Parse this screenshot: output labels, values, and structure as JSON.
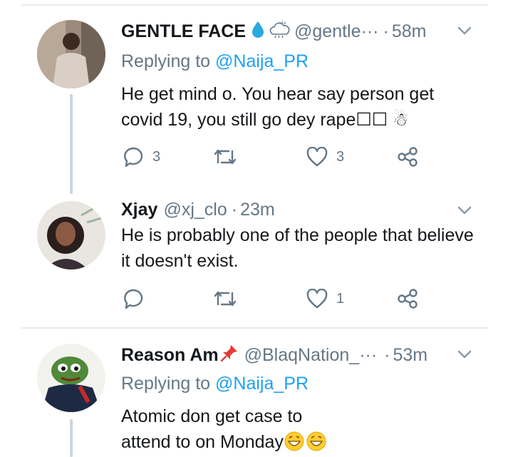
{
  "tweets": [
    {
      "name": "GENTLE FACE",
      "handle": "@gentle···",
      "time": "58m",
      "replying_prefix": "Replying to",
      "replying_to": "@Naija_PR",
      "text": "He get mind o. You hear say person get covid 19, you still go dey rape☐☐ ☃",
      "replies": "3",
      "retweets": "",
      "likes": "3",
      "icons": [
        "water-drop-icon",
        "cloud-emoji-icon",
        "chevron-down-icon",
        "reply-icon",
        "retweet-icon",
        "heart-icon",
        "share-icon"
      ]
    },
    {
      "name": "Xjay",
      "handle": "@xj_clo",
      "time": "23m",
      "text": "He is probably one of the people that believe it doesn't exist.",
      "replies": "",
      "retweets": "",
      "likes": "1",
      "icons": [
        "chevron-down-icon",
        "reply-icon",
        "retweet-icon",
        "heart-icon",
        "share-icon"
      ]
    },
    {
      "name": "Reason Am",
      "handle": "@BlaqNation_···",
      "time": "53m",
      "replying_prefix": "Replying to",
      "replying_to": "@Naija_PR",
      "text": "Atomic don get case to attend to on Monday",
      "icons": [
        "pushpin-icon",
        "chevron-down-icon",
        "grinning-emoji-icon"
      ]
    }
  ],
  "separator": "·",
  "colors": {
    "accent": "#1da1f2",
    "muted": "#657786",
    "text": "#14171a",
    "divider": "#e6ecf0",
    "thread_line": "#ccd6dd"
  }
}
